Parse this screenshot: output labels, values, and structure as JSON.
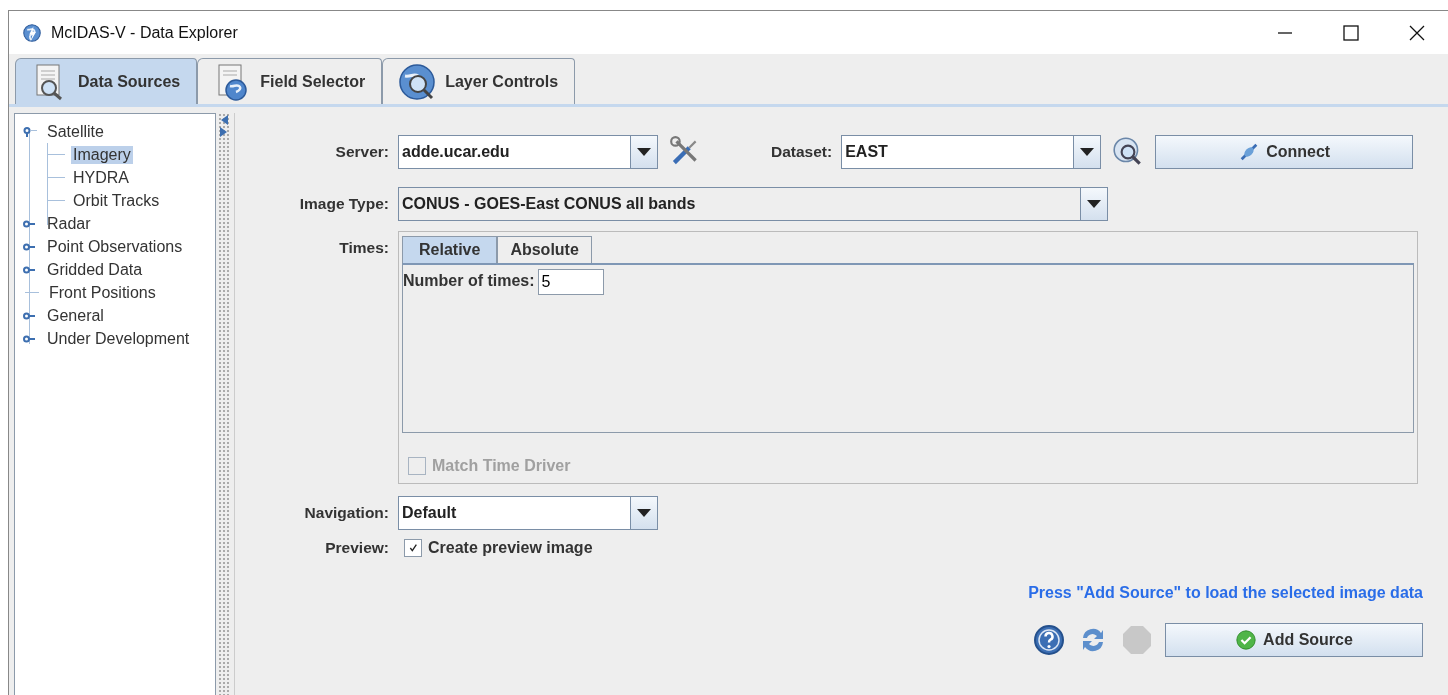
{
  "window": {
    "title": "McIDAS-V - Data Explorer"
  },
  "tabs": [
    {
      "label": "Data Sources",
      "selected": true
    },
    {
      "label": "Field Selector",
      "selected": false
    },
    {
      "label": "Layer Controls",
      "selected": false
    }
  ],
  "tree": [
    {
      "label": "Satellite",
      "kind": "folder",
      "expanded": true,
      "selected": false,
      "children": [
        {
          "label": "Imagery",
          "selected": true
        },
        {
          "label": "HYDRA",
          "selected": false
        },
        {
          "label": "Orbit Tracks",
          "selected": false
        }
      ]
    },
    {
      "label": "Radar",
      "kind": "folder",
      "expanded": false,
      "selected": false
    },
    {
      "label": "Point Observations",
      "kind": "folder",
      "expanded": false,
      "selected": false
    },
    {
      "label": "Gridded Data",
      "kind": "folder",
      "expanded": false,
      "selected": false
    },
    {
      "label": "Front Positions",
      "kind": "leaf",
      "selected": false
    },
    {
      "label": "General",
      "kind": "folder",
      "expanded": false,
      "selected": false
    },
    {
      "label": "Under Development",
      "kind": "folder",
      "expanded": false,
      "selected": false
    }
  ],
  "form": {
    "server": {
      "label": "Server:",
      "value": "adde.ucar.edu"
    },
    "dataset": {
      "label": "Dataset:",
      "value": "EAST"
    },
    "connect_button": "Connect",
    "image_type": {
      "label": "Image Type:",
      "value": "CONUS - GOES-East CONUS all bands"
    },
    "times": {
      "label": "Times:",
      "tabs": [
        {
          "label": "Relative",
          "selected": true
        },
        {
          "label": "Absolute",
          "selected": false
        }
      ],
      "number_of_times": {
        "label": "Number of times:",
        "value": "5"
      },
      "match_time_driver": {
        "label": "Match Time Driver",
        "checked": false,
        "disabled": true
      }
    },
    "navigation": {
      "label": "Navigation:",
      "value": "Default"
    },
    "preview": {
      "label": "Preview:",
      "checkbox_label": "Create preview image",
      "checked": true
    },
    "hint": "Press \"Add Source\" to load the selected image data",
    "add_source_button": "Add Source"
  }
}
